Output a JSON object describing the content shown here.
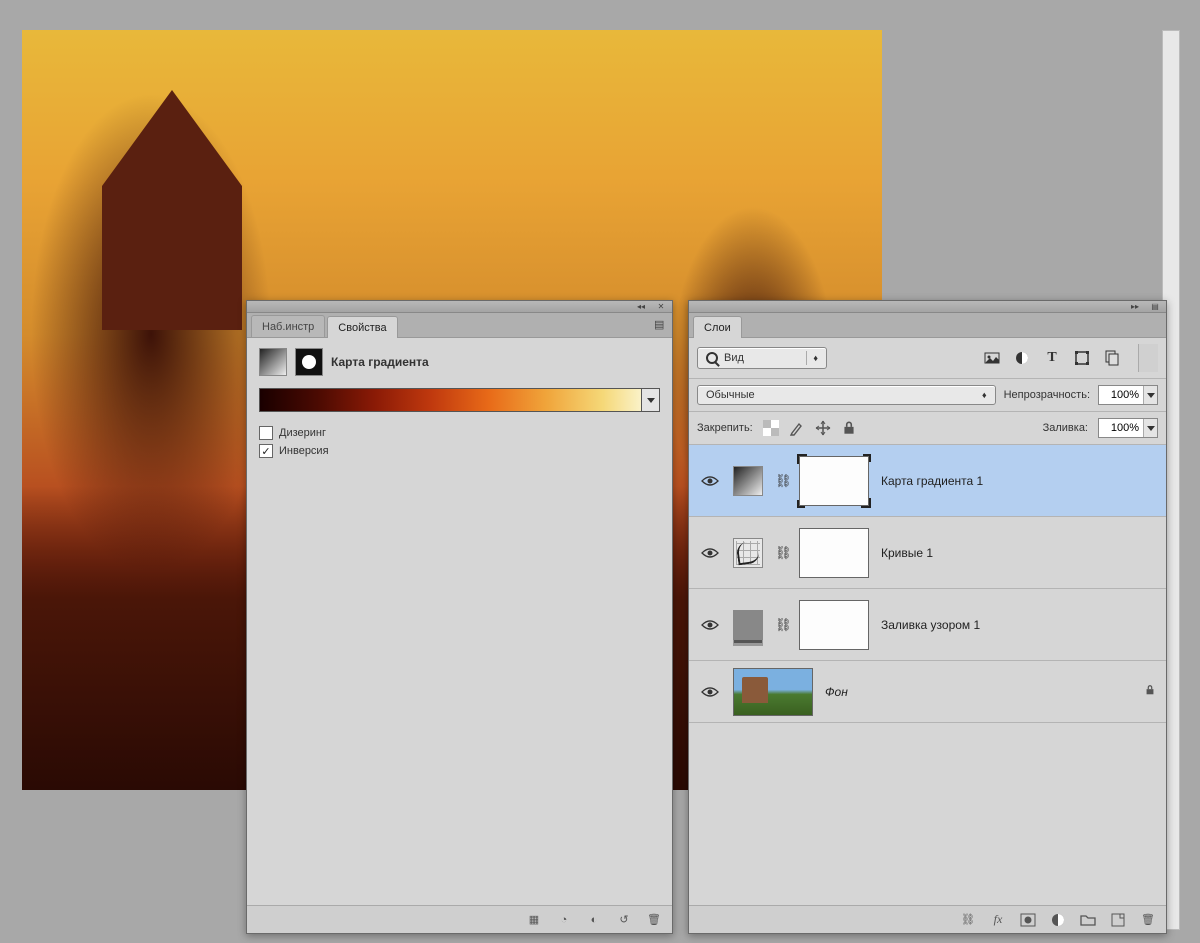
{
  "app": {
    "canvas_bg": "#a8a8a8"
  },
  "properties_panel": {
    "tabs": {
      "presets": "Наб.инстр",
      "properties": "Свойства"
    },
    "title": "Карта градиента",
    "dither_label": "Дизеринг",
    "dither_checked": false,
    "reverse_label": "Инверсия",
    "reverse_checked": true
  },
  "layers_panel": {
    "tab_label": "Слои",
    "kind_label": "Вид",
    "blend_mode": "Обычные",
    "opacity_label": "Непрозрачность:",
    "opacity_value": "100%",
    "lock_label": "Закрепить:",
    "fill_label": "Заливка:",
    "fill_value": "100%",
    "layers": [
      {
        "name": "Карта градиента 1",
        "type": "gradmap",
        "selected": true
      },
      {
        "name": "Кривые 1",
        "type": "curves",
        "selected": false
      },
      {
        "name": "Заливка узором 1",
        "type": "pattern",
        "selected": false
      },
      {
        "name": "Фон",
        "type": "background",
        "locked": true
      }
    ]
  }
}
